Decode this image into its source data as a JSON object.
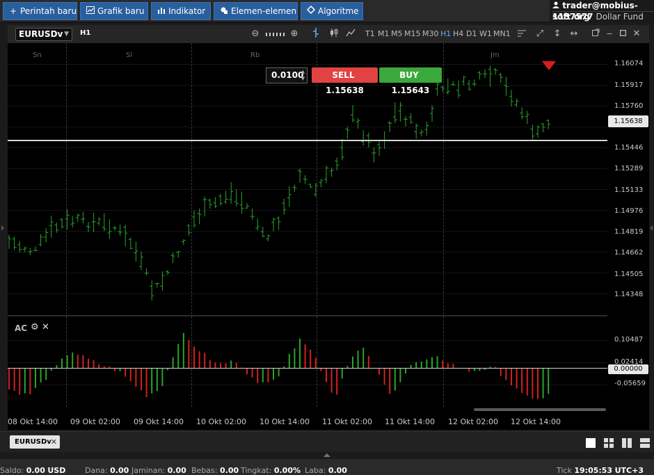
{
  "toolbar": {
    "buttons": [
      {
        "label": "Perintah baru",
        "icon": "plus-icon"
      },
      {
        "label": "Grafik baru",
        "icon": "line-chart-icon"
      },
      {
        "label": "Indikator",
        "icon": "bar-chart-icon"
      },
      {
        "label": "Elemen-elemen",
        "icon": "shapes-icon"
      },
      {
        "label": "Algoritme",
        "icon": "diamond-icon"
      }
    ]
  },
  "account": {
    "email": "trader@mobius-soft.org",
    "number": "1137577",
    "fund": "Dollar Fund"
  },
  "chart": {
    "symbol": "EURUSDv",
    "current_timeframe": "H1",
    "timeframes": [
      "T1",
      "M1",
      "M5",
      "M15",
      "M30",
      "H1",
      "H4",
      "D1",
      "W1",
      "MN1"
    ],
    "active_timeframe": "H1",
    "day_labels": [
      "Sn",
      "Sl",
      "Rb",
      "Jm"
    ],
    "lot": "0.0100",
    "sell_label": "SELL",
    "sell_price": "1.15638",
    "buy_label": "BUY",
    "buy_price": "1.15643",
    "current_price": "1.15638",
    "price_ticks": [
      "1.16074",
      "1.15917",
      "1.15760",
      "1.15446",
      "1.15289",
      "1.15133",
      "1.14976",
      "1.14819",
      "1.14662",
      "1.14505",
      "1.14348"
    ],
    "time_ticks": [
      "08 Okt 14:00",
      "09 Okt 02:00",
      "09 Okt 14:00",
      "10 Okt 02:00",
      "10 Okt 14:00",
      "11 Okt 02:00",
      "11 Okt 14:00",
      "12 Okt 02:00",
      "12 Okt 14:00"
    ],
    "colors": {
      "up": "#2aa52a",
      "down": "#d42020",
      "sell": "#e24242",
      "buy": "#3aa83a"
    }
  },
  "indicator": {
    "name": "AC",
    "ticks": [
      "0.10487",
      "0.02414"
    ],
    "zero_label": "0.00000",
    "neg_tick": "-0.05659"
  },
  "chart_data": {
    "type": "bar",
    "title": "",
    "series_price": {
      "first": 1.1475,
      "last": 1.1564,
      "max": 1.1612,
      "min": 1.1433
    },
    "x": [
      "08 Okt 14:00",
      "09 Okt 02:00",
      "09 Okt 14:00",
      "10 Okt 02:00",
      "10 Okt 14:00",
      "11 Okt 02:00",
      "11 Okt 14:00",
      "12 Okt 02:00",
      "12 Okt 14:00"
    ],
    "ylim": [
      1.1425,
      1.162
    ]
  },
  "tabs": [
    {
      "label": "EURUSDv"
    }
  ],
  "status": {
    "saldo_label": "Saldo:",
    "saldo_value": "0.00",
    "saldo_cur": "USD",
    "dana_label": "Dana:",
    "dana_value": "0.00",
    "jaminan_label": "Jaminan:",
    "jaminan_value": "0.00",
    "bebas_label": "Bebas:",
    "bebas_value": "0.00",
    "tingkat_label": "Tingkat:",
    "tingkat_value": "0.00%",
    "laba_label": "Laba:",
    "laba_value": "0.00",
    "tick_label": "Tick",
    "time": "19:05:53",
    "tz": "UTC+3"
  }
}
